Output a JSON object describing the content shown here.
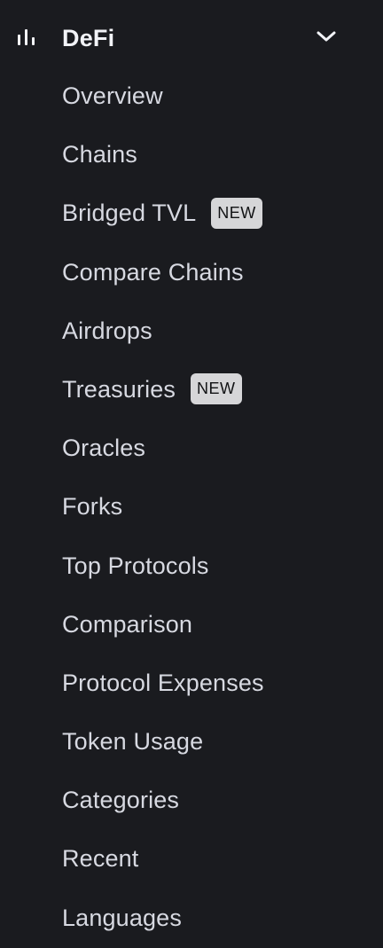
{
  "section": {
    "title": "DeFi",
    "icon": "bar-chart-icon",
    "expanded": true,
    "chevron_icon": "chevron-down-icon"
  },
  "nav": {
    "items": [
      {
        "label": "Overview"
      },
      {
        "label": "Chains"
      },
      {
        "label": "Bridged TVL",
        "badge": "NEW"
      },
      {
        "label": "Compare Chains"
      },
      {
        "label": "Airdrops"
      },
      {
        "label": "Treasuries",
        "badge": "NEW"
      },
      {
        "label": "Oracles"
      },
      {
        "label": "Forks"
      },
      {
        "label": "Top Protocols"
      },
      {
        "label": "Comparison"
      },
      {
        "label": "Protocol Expenses"
      },
      {
        "label": "Token Usage"
      },
      {
        "label": "Categories"
      },
      {
        "label": "Recent"
      },
      {
        "label": "Languages"
      }
    ]
  },
  "colors": {
    "background": "#1a1b1f",
    "text": "#d7d9e1",
    "title": "#f2f3f7",
    "badge_bg": "#d6d6d8",
    "badge_text": "#111214"
  }
}
